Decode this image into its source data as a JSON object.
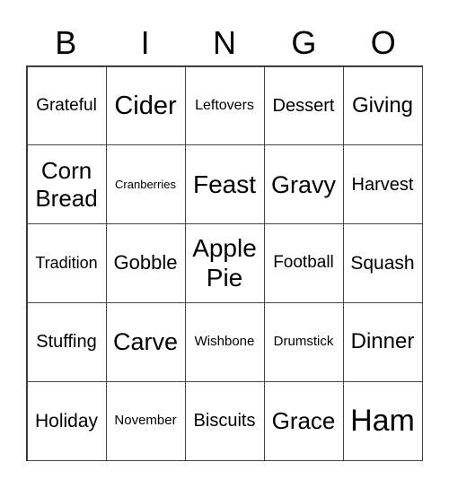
{
  "header": [
    "B",
    "I",
    "N",
    "G",
    "O"
  ],
  "cells": [
    [
      "Grateful",
      "Cider",
      "Leftovers",
      "Dessert",
      "Giving"
    ],
    [
      "Corn Bread",
      "Cranberries",
      "Feast",
      "Gravy",
      "Harvest"
    ],
    [
      "Tradition",
      "Gobble",
      "Apple Pie",
      "Football",
      "Squash"
    ],
    [
      "Stuffing",
      "Carve",
      "Wishbone",
      "Drumstick",
      "Dinner"
    ],
    [
      "Holiday",
      "November",
      "Biscuits",
      "Grace",
      "Ham"
    ]
  ]
}
